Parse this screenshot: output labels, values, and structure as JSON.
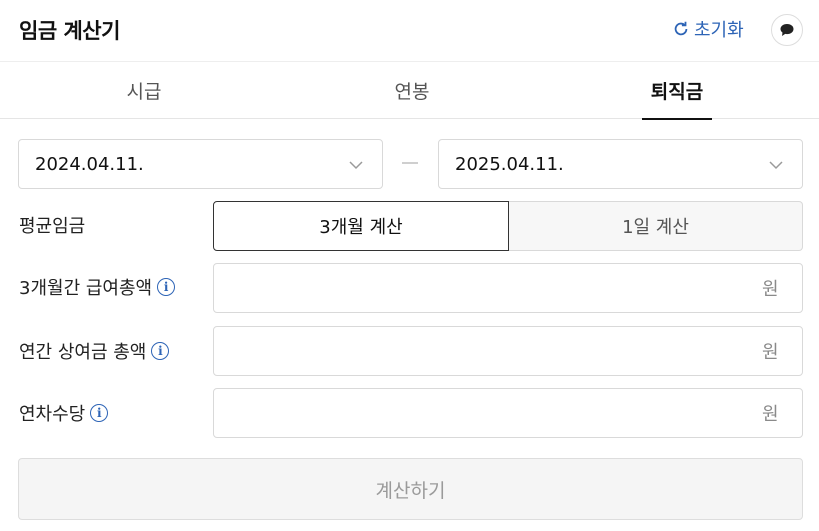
{
  "header": {
    "title": "임금 계산기",
    "reset_label": "초기화"
  },
  "tabs": [
    {
      "label": "시급",
      "active": false
    },
    {
      "label": "연봉",
      "active": false
    },
    {
      "label": "퇴직금",
      "active": true
    }
  ],
  "dates": {
    "start": "2024.04.11.",
    "end": "2025.04.11."
  },
  "average_wage": {
    "label": "평균임금",
    "options": [
      "3개월 계산",
      "1일 계산"
    ],
    "selected": "3개월 계산"
  },
  "fields": [
    {
      "label": "3개월간 급여총액",
      "value": "",
      "unit": "원"
    },
    {
      "label": "연간 상여금 총액",
      "value": "",
      "unit": "원"
    },
    {
      "label": "연차수당",
      "value": "",
      "unit": "원"
    }
  ],
  "calculate_label": "계산하기",
  "colors": {
    "accent": "#2d64b6",
    "disabled_text": "#9a9a9a"
  }
}
